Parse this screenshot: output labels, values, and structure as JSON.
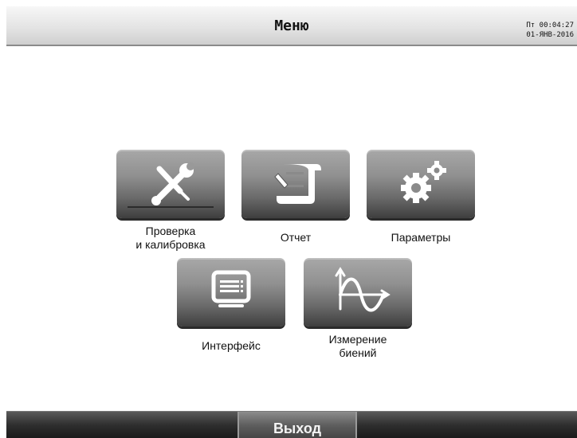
{
  "header": {
    "title": "Меню",
    "clock_line1": "Пт 00:04:27",
    "clock_line2": "01-ЯНВ-2016"
  },
  "menu": {
    "calibration_label": "Проверка\nи калибровка",
    "calibration_icon": "wrench-screwdriver-icon",
    "report_label": "Отчет",
    "report_icon": "report-scroll-icon",
    "parameters_label": "Параметры",
    "parameters_icon": "gears-icon",
    "interface_label": "Интерфейс",
    "interface_icon": "monitor-icon",
    "beat_label": "Измерение\nбиений",
    "beat_icon": "sine-wave-icon"
  },
  "footer": {
    "exit_label": "Выход"
  },
  "colors": {
    "tile": "#8a8a8a",
    "icon": "#ffffff",
    "footer": "#2e2e2e"
  }
}
